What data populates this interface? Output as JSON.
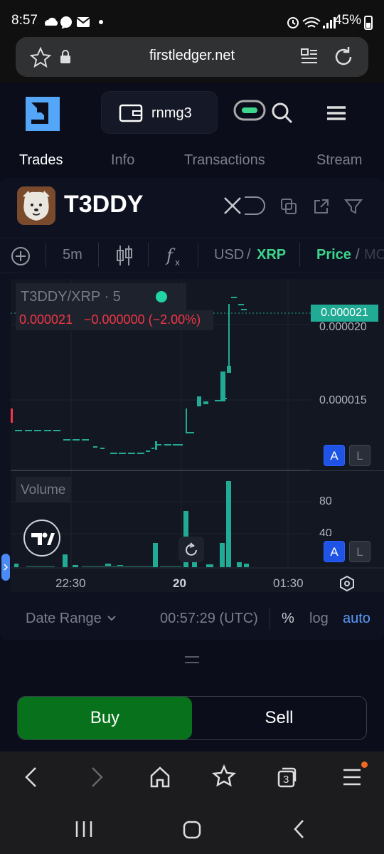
{
  "status_bar": {
    "time": "8:57",
    "battery": "45%"
  },
  "browser": {
    "url": "firstledger.net",
    "tab_count": "3"
  },
  "header": {
    "wallet_name": "rnmg3"
  },
  "tabs": [
    "Trades",
    "Info",
    "Transactions",
    "Stream"
  ],
  "token": {
    "name": "T3DDY"
  },
  "toolbar": {
    "interval": "5m",
    "currency_usd": "USD",
    "currency_sep": "/",
    "currency_xrp": "XRP",
    "price_label": "Price",
    "price_sep": "/",
    "mcap_label": "MC"
  },
  "chart": {
    "legend_symbol": "T3DDY/XRP · 5",
    "legend_price": "0.000021",
    "legend_change": "−0.000000 (−2.00%)",
    "last_price": "0.000021",
    "price_axis": [
      "0.000020",
      "0.000015"
    ],
    "volume_label": "Volume",
    "volume_axis": [
      "80",
      "40"
    ],
    "time_axis": [
      "22:30",
      "20",
      "01:30"
    ],
    "autoscale_label": "A",
    "log_label": "L",
    "accent_up": "#22ab94",
    "accent_down": "#f23645"
  },
  "chart_data": {
    "type": "candlestick",
    "title": "T3DDY/XRP · 5",
    "x_ticks": [
      "22:30",
      "20",
      "01:30"
    ],
    "y_ticks": [
      1.5e-05,
      2e-05
    ],
    "last": 2.1e-05,
    "volume_ticks": [
      40,
      80
    ]
  },
  "chart_footer": {
    "date_range": "Date Range",
    "clock": "00:57:29 (UTC)",
    "percent": "%",
    "log": "log",
    "auto": "auto"
  },
  "actions": {
    "buy": "Buy",
    "sell": "Sell"
  }
}
